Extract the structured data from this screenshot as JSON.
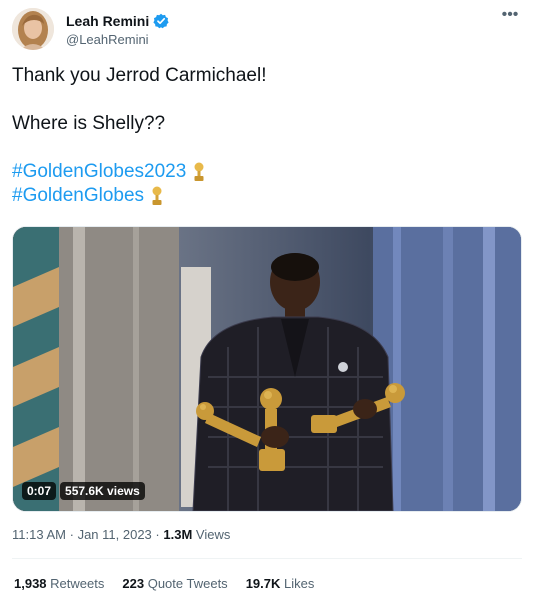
{
  "user": {
    "display_name": "Leah Remini",
    "handle": "@LeahRemini",
    "verified_icon": "verified-badge-icon",
    "avatar_icon": "profile-avatar"
  },
  "menu": {
    "more_label": "•••"
  },
  "tweet": {
    "line1": "Thank you Jerrod Carmichael!",
    "line2": "Where is Shelly??",
    "hashtag1": "#GoldenGlobes2023",
    "hashtag2": "#GoldenGlobes",
    "hashtag_emoji": "golden-globe-icon"
  },
  "video": {
    "duration": "0:07",
    "views": "557.6K views"
  },
  "meta": {
    "time": "11:13 AM",
    "separator": "·",
    "date": "Jan 11, 2023",
    "views_count": "1.3M",
    "views_label": "Views"
  },
  "stats": {
    "retweets_count": "1,938",
    "retweets_label": "Retweets",
    "quotes_count": "223",
    "quotes_label": "Quote Tweets",
    "likes_count": "19.7K",
    "likes_label": "Likes"
  },
  "colors": {
    "hashtag": "#1d9bf0",
    "secondary_text": "#536471",
    "primary_text": "#0f1419",
    "verified": "#1d9bf0"
  }
}
